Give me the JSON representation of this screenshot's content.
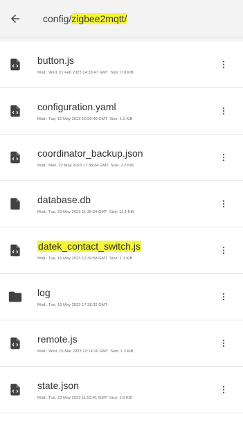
{
  "header": {
    "path_prefix": "config/",
    "path_highlight": "zigbee2mqtt/",
    "back_icon": "arrow-left-icon"
  },
  "files": [
    {
      "name": "button.js",
      "highlighted": false,
      "icon": "code-file-icon",
      "modified": "Mod.: Wed, 01 Feb 2023 14:33:47 GMT",
      "size": "Size: 0.0 KiB"
    },
    {
      "name": "configuration.yaml",
      "highlighted": false,
      "icon": "code-file-icon",
      "modified": "Mod.: Tue, 16 May 2023 16:50:40 GMT",
      "size": "Size: 1.3 KiB"
    },
    {
      "name": "coordinator_backup.json",
      "highlighted": false,
      "icon": "code-file-icon",
      "modified": "Mod.: Mon, 22 May 2023 17:38:34 GMT",
      "size": "Size: 2.2 KiB"
    },
    {
      "name": "database.db",
      "highlighted": false,
      "icon": "file-icon",
      "modified": "Mod.: Tue, 23 May 2023 11:38:34 GMT",
      "size": "Size: 11.1 KiB"
    },
    {
      "name": "datek_contact_switch.js",
      "highlighted": true,
      "icon": "code-file-icon",
      "modified": "Mod.: Tue, 16 May 2023 12:30:58 GMT",
      "size": "Size: 1.3 KiB"
    },
    {
      "name": "log",
      "highlighted": false,
      "icon": "folder-icon",
      "modified": "Mod.: Tue, 16 May 2023 17:38:32 GMT",
      "size": ""
    },
    {
      "name": "remote.js",
      "highlighted": false,
      "icon": "code-file-icon",
      "modified": "Mod.: Wed, 15 Mar 2023 12:14:10 GMT",
      "size": "Size: 1.2 KiB"
    },
    {
      "name": "state.json",
      "highlighted": false,
      "icon": "code-file-icon",
      "modified": "Mod.: Tue, 23 May 2023 11:53:41 GMT",
      "size": "Size: 1.0 KiB"
    }
  ]
}
